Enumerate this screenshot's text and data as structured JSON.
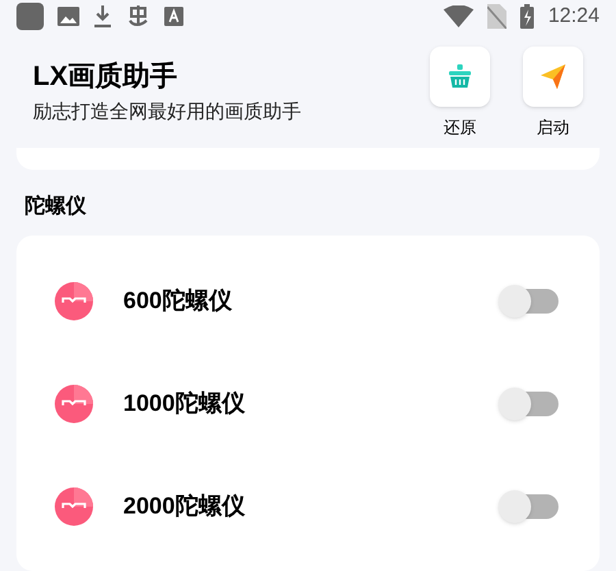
{
  "status_bar": {
    "time": "12:24"
  },
  "header": {
    "title": "LX画质助手",
    "subtitle": "励志打造全网最好用的画质助手",
    "actions": [
      {
        "kind": "restore",
        "label": "还原"
      },
      {
        "kind": "launch",
        "label": "启动"
      }
    ]
  },
  "section": {
    "title": "陀螺仪",
    "items": [
      {
        "label": "600陀螺仪",
        "on": false
      },
      {
        "label": "1000陀螺仪",
        "on": false
      },
      {
        "label": "2000陀螺仪",
        "on": false
      }
    ]
  }
}
